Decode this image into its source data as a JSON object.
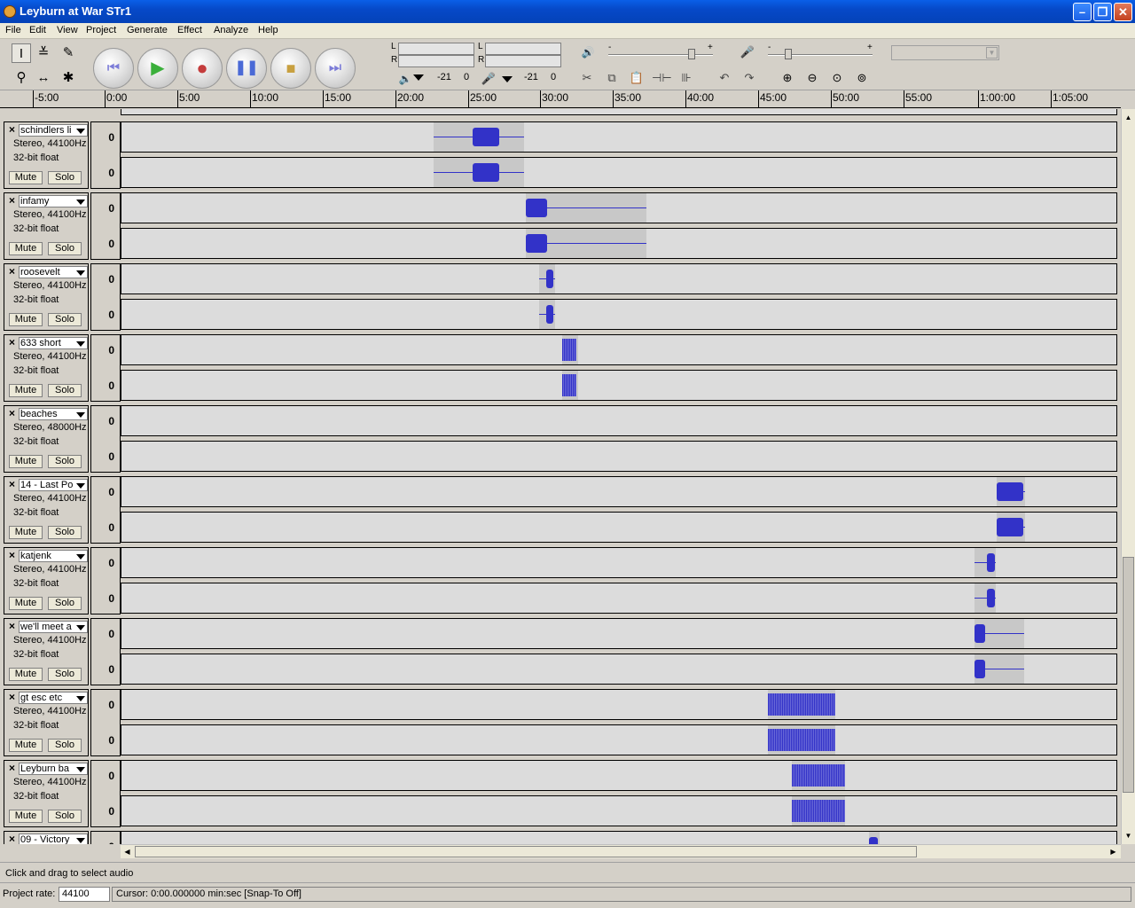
{
  "window": {
    "title": "Leyburn at War STr1"
  },
  "menu": [
    "File",
    "Edit",
    "View",
    "Project",
    "Generate",
    "Effect",
    "Analyze",
    "Help"
  ],
  "meters": {
    "play": {
      "L": "L",
      "R": "R",
      "min": "-21",
      "zero": "0"
    },
    "rec": {
      "L": "L",
      "R": "R",
      "min": "-21",
      "zero": "0"
    }
  },
  "sliders": {
    "minus": "-",
    "plus": "+"
  },
  "ruler": {
    "labels": [
      "-5:00",
      "0:00",
      "5:00",
      "10:00",
      "15:00",
      "20:00",
      "25:00",
      "30:00",
      "35:00",
      "40:00",
      "45:00",
      "50:00",
      "55:00",
      "1:00:00",
      "1:05:00"
    ]
  },
  "buttons": {
    "mute": "Mute",
    "solo": "Solo",
    "close": "×"
  },
  "vruler_label": "0",
  "tracks": [
    {
      "name": "schindlers li",
      "format": "Stereo, 44100Hz",
      "bits": "32-bit float"
    },
    {
      "name": "infamy",
      "format": "Stereo, 44100Hz",
      "bits": "32-bit float"
    },
    {
      "name": "roosevelt",
      "format": "Stereo, 44100Hz",
      "bits": "32-bit float"
    },
    {
      "name": "633 short",
      "format": "Stereo, 44100Hz",
      "bits": "32-bit float"
    },
    {
      "name": "beaches",
      "format": "Stereo, 48000Hz",
      "bits": "32-bit float"
    },
    {
      "name": "14 - Last Po",
      "format": "Stereo, 44100Hz",
      "bits": "32-bit float"
    },
    {
      "name": "katjenk",
      "format": "Stereo, 44100Hz",
      "bits": "32-bit float"
    },
    {
      "name": "we'll meet a",
      "format": "Stereo, 44100Hz",
      "bits": "32-bit float"
    },
    {
      "name": "gt esc etc",
      "format": "Stereo, 44100Hz",
      "bits": "32-bit float"
    },
    {
      "name": "Leyburn ba",
      "format": "Stereo, 44100Hz",
      "bits": "32-bit float"
    },
    {
      "name": "09 - Victory",
      "format": "",
      "bits": ""
    }
  ],
  "status": {
    "message": "Click and drag to select audio",
    "project_rate_label": "Project rate:",
    "project_rate_value": "44100",
    "cursor": "Cursor: 0:00.000000 min:sec  [Snap-To Off]"
  },
  "icons": {
    "window": "audacity-icon",
    "tools": [
      "selection-tool-icon",
      "envelope-tool-icon",
      "draw-tool-icon",
      "zoom-tool-icon",
      "timeshift-tool-icon",
      "multi-tool-icon"
    ],
    "transport": [
      "skip-start-icon",
      "play-icon",
      "record-icon",
      "pause-icon",
      "stop-icon",
      "skip-end-icon"
    ]
  }
}
